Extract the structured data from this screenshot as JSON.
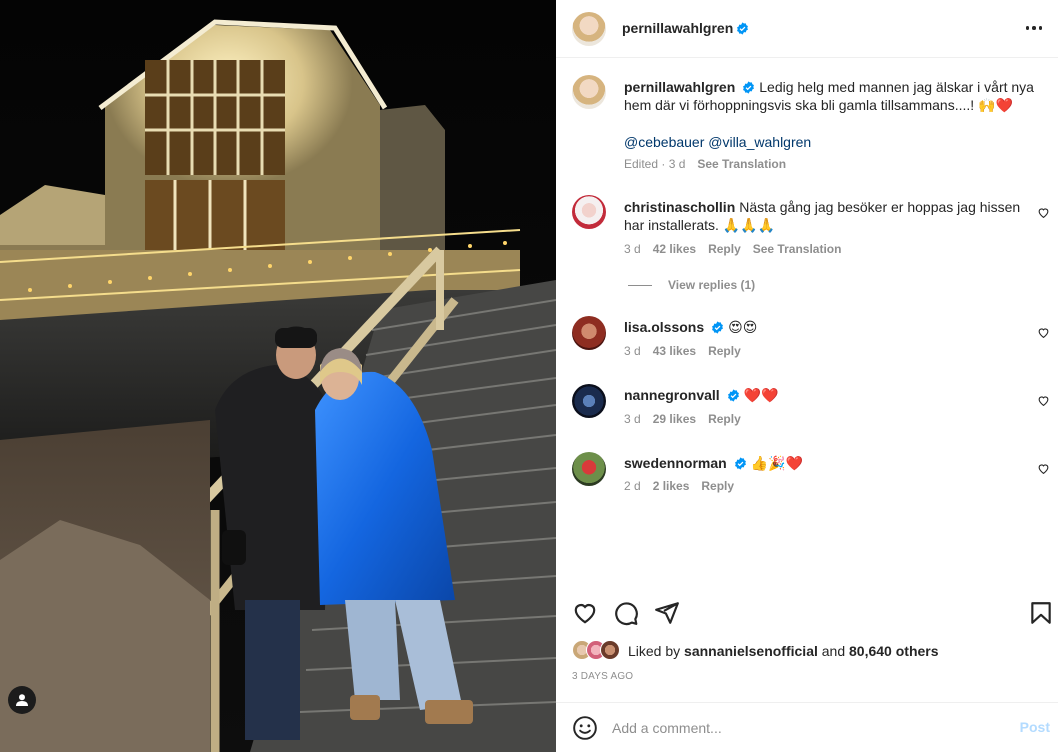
{
  "post": {
    "author": "pernillawahlgren",
    "caption_text": "Ledig helg med mannen jag älskar i vårt nya hem där vi förhoppningsvis ska bli gamla tillsammans....! 🙌❤️",
    "caption_mentions": "@cebebauer @villa_wahlgren",
    "caption_time": "Edited · 3 d",
    "caption_translate": "See Translation",
    "liked_by_prefix": "Liked by",
    "liked_by_user": "sannanielsenofficial",
    "liked_by_and": "and",
    "liked_by_count": "80,640 others",
    "date": "3 DAYS AGO"
  },
  "comments": [
    {
      "user": "christinaschollin",
      "text": "Nästa gång jag besöker er hoppas jag hissen har installerats. 🙏🙏🙏",
      "time": "3 d",
      "likes": "42 likes",
      "reply": "Reply",
      "translate": "See Translation"
    },
    {
      "user": "lisa.olssons",
      "text": "😍😍",
      "time": "3 d",
      "likes": "43 likes",
      "reply": "Reply"
    },
    {
      "user": "nannegronvall",
      "text": "❤️❤️",
      "time": "3 d",
      "likes": "29 likes",
      "reply": "Reply"
    },
    {
      "user": "swedennorman",
      "text": "👍🎉❤️",
      "time": "2 d",
      "likes": "2 likes",
      "reply": "Reply"
    }
  ],
  "view_replies": "View replies (1)",
  "add_comment": {
    "placeholder": "Add a comment...",
    "post_label": "Post"
  },
  "colors": {
    "verified": "#0095f6",
    "link": "#00376b",
    "secondary_text": "#8e8e8e",
    "post_disabled": "#b3dbff"
  },
  "icons": [
    "user-tag-icon",
    "verified-icon",
    "more-icon",
    "heart-icon",
    "comment-icon",
    "share-icon",
    "bookmark-icon",
    "emoji-icon"
  ]
}
